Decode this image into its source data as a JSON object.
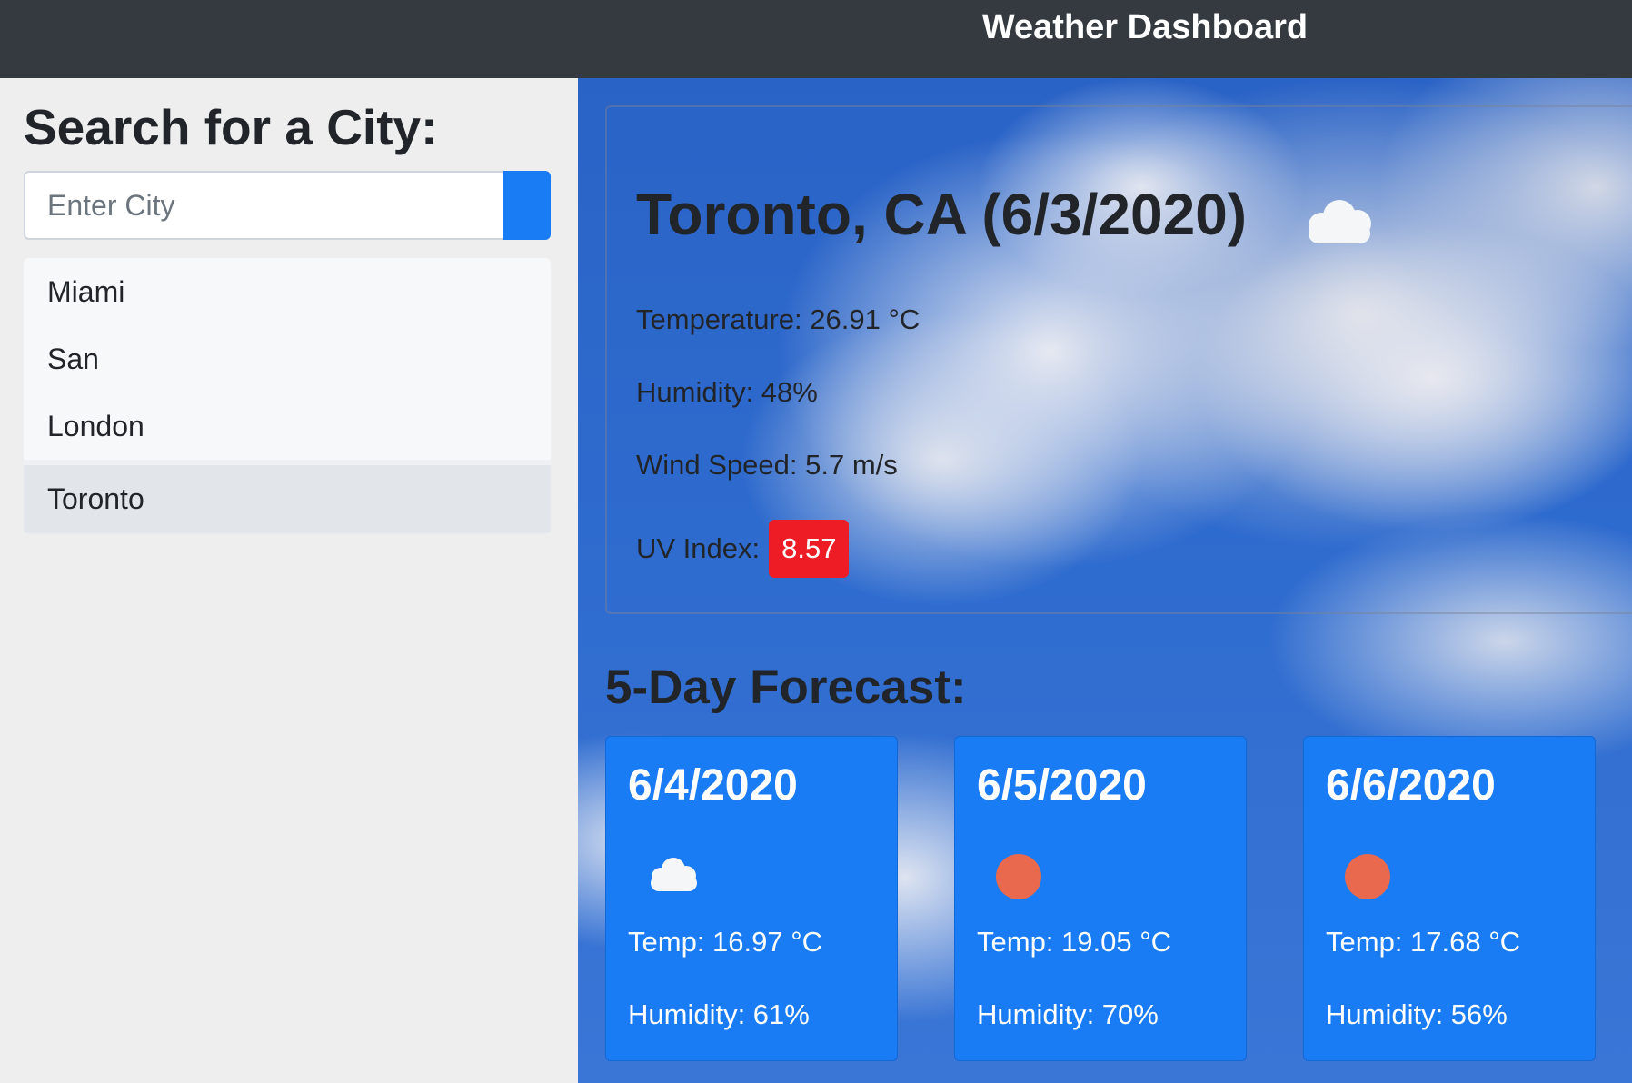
{
  "navbar": {
    "title": "Weather Dashboard"
  },
  "sidebar": {
    "heading": "Search for a City:",
    "search": {
      "placeholder": "Enter City",
      "value": ""
    },
    "history": [
      {
        "label": "Miami",
        "active": false
      },
      {
        "label": "San",
        "active": false
      },
      {
        "label": "London",
        "active": false
      },
      {
        "label": "Toronto",
        "active": true
      }
    ]
  },
  "current": {
    "title": "Toronto, CA (6/3/2020)",
    "icon": "cloud-icon",
    "temperature": "Temperature: 26.91 °C",
    "humidity": "Humidity: 48%",
    "wind": "Wind Speed: 5.7 m/s",
    "uv_label": "UV Index:",
    "uv_value": "8.57",
    "uv_color": "#ee1c25"
  },
  "forecast": {
    "heading": "5-Day Forecast:",
    "days": [
      {
        "date": "6/4/2020",
        "icon": "cloud-icon",
        "temp": "Temp: 16.97 °C",
        "humidity": "Humidity: 61%"
      },
      {
        "date": "6/5/2020",
        "icon": "sun-icon",
        "temp": "Temp: 19.05 °C",
        "humidity": "Humidity: 70%"
      },
      {
        "date": "6/6/2020",
        "icon": "sun-icon",
        "temp": "Temp: 17.68 °C",
        "humidity": "Humidity: 56%"
      }
    ]
  },
  "colors": {
    "navbar": "#343a40",
    "accent": "#1a7cf5",
    "sun": "#e8694e"
  }
}
